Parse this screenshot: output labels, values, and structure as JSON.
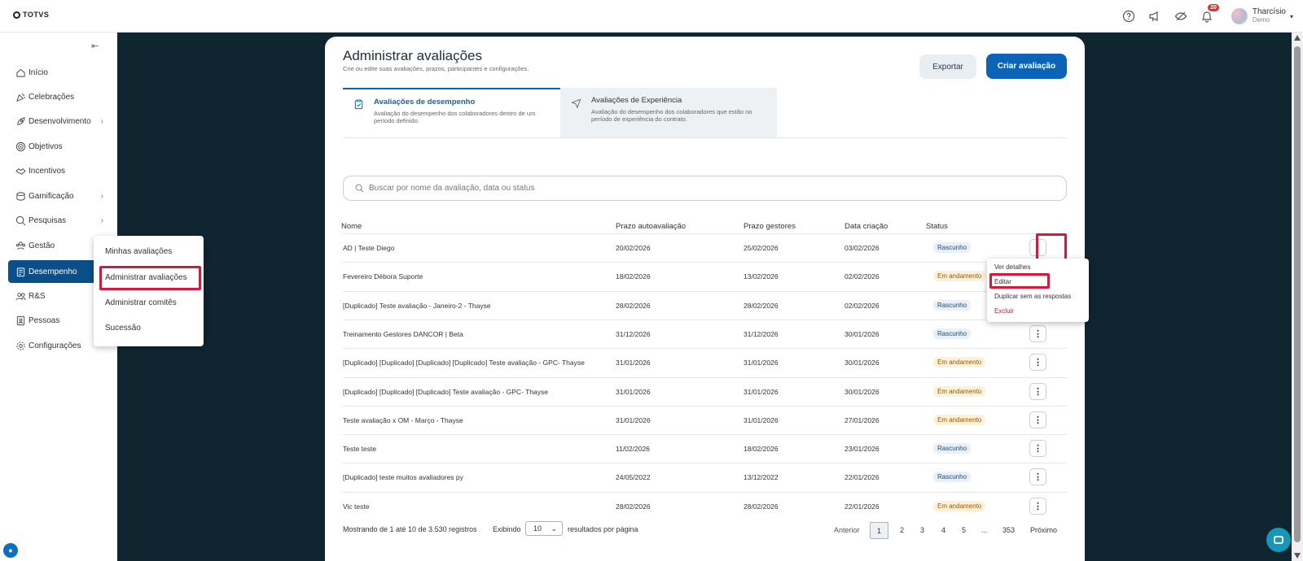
{
  "app": {
    "brand": "TOTVS",
    "notifications_count": "20",
    "user_name": "Tharcísio",
    "user_role": "Demo"
  },
  "sidebar": {
    "items": [
      {
        "label": "Início",
        "icon": "home-icon"
      },
      {
        "label": "Celebrações",
        "icon": "party-icon"
      },
      {
        "label": "Desenvolvimento",
        "icon": "rocket-icon"
      },
      {
        "label": "Objetivos",
        "icon": "target-icon"
      },
      {
        "label": "Incentivos",
        "icon": "handshake-icon"
      },
      {
        "label": "Gamificação",
        "icon": "coins-icon"
      },
      {
        "label": "Pesquisas",
        "icon": "search-survey-icon"
      },
      {
        "label": "Gestão",
        "icon": "team-icon"
      },
      {
        "label": "Desempenho",
        "icon": "clipboard-icon"
      },
      {
        "label": "R&S",
        "icon": "users-icon"
      },
      {
        "label": "Pessoas",
        "icon": "id-card-icon"
      },
      {
        "label": "Configurações",
        "icon": "gear-icon"
      }
    ],
    "active": "Desempenho"
  },
  "submenu": {
    "items": [
      "Minhas avaliações",
      "Administrar avaliações",
      "Administrar comitês",
      "Sucessão"
    ],
    "highlighted": "Administrar avaliações"
  },
  "page": {
    "title": "Administrar avaliações",
    "subtitle": "Crie ou edite suas avaliações, prazos, participantes e configurações.",
    "export_label": "Exportar",
    "create_label": "Criar avaliação"
  },
  "tabs": [
    {
      "title": "Avaliações de desempenho",
      "desc": "Avaliação do desempenho dos colaboradores dentro de um período definido."
    },
    {
      "title": "Avaliações de Experiência",
      "desc": "Avaliação do desempenho dos colaboradores que estão no período de experiência do contrato."
    }
  ],
  "search": {
    "placeholder": "Buscar por nome da avaliação, data ou status"
  },
  "table": {
    "columns": [
      "Nome",
      "Prazo autoavaliação",
      "Prazo gestores",
      "Data criação",
      "Status"
    ],
    "rows": [
      {
        "name": "AD | Teste Diego",
        "self": "20/02/2026",
        "managers": "25/02/2026",
        "created": "03/02/2026",
        "status": "Rascunho",
        "kind": "draft"
      },
      {
        "name": "Fevereiro Débora Suporte",
        "self": "18/02/2026",
        "managers": "13/02/2026",
        "created": "02/02/2026",
        "status": "Em andamento",
        "kind": "progress"
      },
      {
        "name": "[Duplicado] Teste avaliação - Janeiro-2 - Thayse",
        "self": "28/02/2026",
        "managers": "28/02/2026",
        "created": "02/02/2026",
        "status": "Rascunho",
        "kind": "draft"
      },
      {
        "name": "Treinamento Gestores DANCOR | Beta",
        "self": "31/12/2026",
        "managers": "31/12/2026",
        "created": "30/01/2026",
        "status": "Rascunho",
        "kind": "draft"
      },
      {
        "name": "[Duplicado] [Duplicado] [Duplicado] [Duplicado] Teste avaliação - GPC- Thayse",
        "self": "31/01/2026",
        "managers": "31/01/2026",
        "created": "30/01/2026",
        "status": "Em andamento",
        "kind": "progress"
      },
      {
        "name": "[Duplicado] [Duplicado] [Duplicado] Teste avaliação - GPC- Thayse",
        "self": "31/01/2026",
        "managers": "31/01/2026",
        "created": "30/01/2026",
        "status": "Em andamento",
        "kind": "progress"
      },
      {
        "name": "Teste avaliação x OM - Março - Thayse",
        "self": "31/01/2026",
        "managers": "31/01/2026",
        "created": "27/01/2026",
        "status": "Em andamento",
        "kind": "progress"
      },
      {
        "name": "Teste teste",
        "self": "11/02/2026",
        "managers": "18/02/2026",
        "created": "23/01/2026",
        "status": "Rascunho",
        "kind": "draft"
      },
      {
        "name": "[Duplicado] teste muitos avaliadores py",
        "self": "24/05/2022",
        "managers": "13/12/2022",
        "created": "22/01/2026",
        "status": "Rascunho",
        "kind": "draft"
      },
      {
        "name": "Vic teste",
        "self": "28/02/2026",
        "managers": "28/02/2026",
        "created": "22/01/2026",
        "status": "Em andamento",
        "kind": "progress"
      }
    ]
  },
  "context_menu": {
    "items": [
      "Ver detalhes",
      "Editar",
      "Duplicar sem as respostas",
      "Excluir"
    ],
    "highlighted": "Editar"
  },
  "footer": {
    "showing": "Mostrando de 1 até 10 de 3.530 registros",
    "showing_label": "Exibindo",
    "per_page": "10",
    "per_page_suffix": "resultados por página",
    "prev": "Anterior",
    "pages": [
      "1",
      "2",
      "3",
      "4",
      "5",
      "...",
      "353"
    ],
    "current_page": "1",
    "next": "Próximo"
  },
  "colors": {
    "primary": "#0b64b8",
    "sidebar_active": "#0b4f8a",
    "highlight": "#d9173a",
    "backdrop": "#0f2530"
  }
}
